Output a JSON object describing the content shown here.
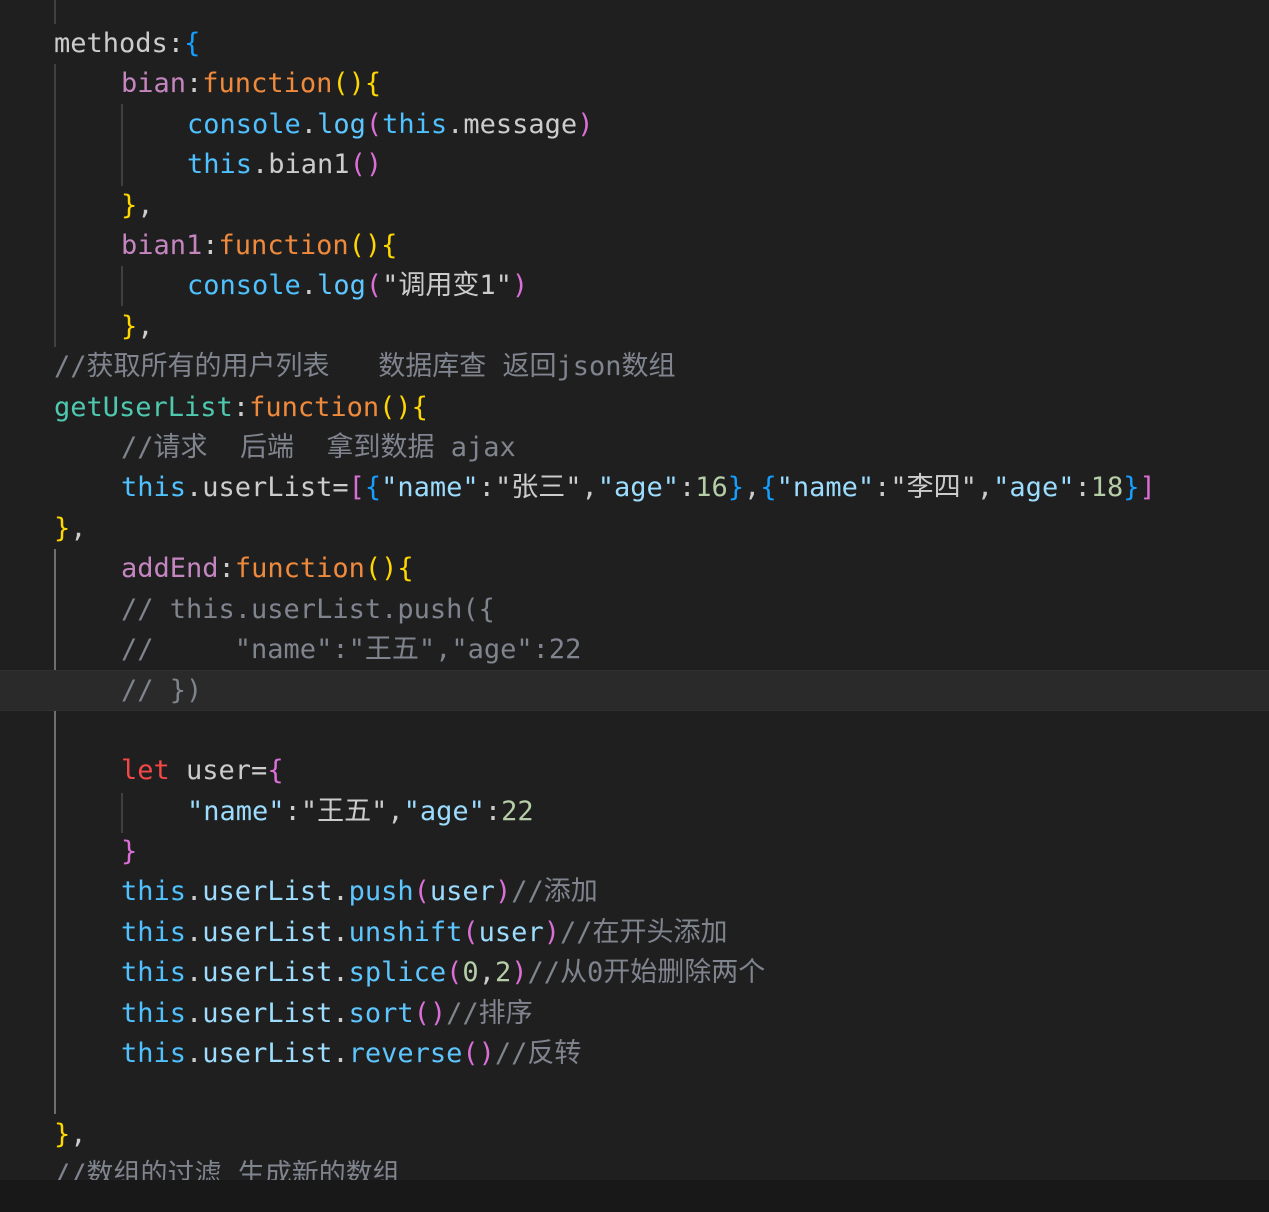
{
  "editor": {
    "lines": [
      {
        "indent": 1,
        "tokens": [
          {
            "t": "methods",
            "c": "def"
          },
          {
            "t": ":",
            "c": "def"
          },
          {
            "t": "{",
            "c": "b3"
          }
        ]
      },
      {
        "indent": 2,
        "tokens": [
          {
            "t": "bian",
            "c": "prop"
          },
          {
            "t": ":",
            "c": "def"
          },
          {
            "t": "function",
            "c": "fn"
          },
          {
            "t": "()",
            "c": "b1"
          },
          {
            "t": "{",
            "c": "b1"
          }
        ]
      },
      {
        "indent": 3,
        "tokens": [
          {
            "t": "console",
            "c": "obj"
          },
          {
            "t": ".",
            "c": "def"
          },
          {
            "t": "log",
            "c": "blue"
          },
          {
            "t": "(",
            "c": "b2"
          },
          {
            "t": "this",
            "c": "obj"
          },
          {
            "t": ".message",
            "c": "def"
          },
          {
            "t": ")",
            "c": "b2"
          }
        ]
      },
      {
        "indent": 3,
        "tokens": [
          {
            "t": "this",
            "c": "obj"
          },
          {
            "t": ".bian1",
            "c": "def"
          },
          {
            "t": "()",
            "c": "b2"
          }
        ]
      },
      {
        "indent": 2,
        "tokens": [
          {
            "t": "}",
            "c": "b1"
          },
          {
            "t": ",",
            "c": "def"
          }
        ]
      },
      {
        "indent": 2,
        "tokens": [
          {
            "t": "bian1",
            "c": "prop"
          },
          {
            "t": ":",
            "c": "def"
          },
          {
            "t": "function",
            "c": "fn"
          },
          {
            "t": "()",
            "c": "b1"
          },
          {
            "t": "{",
            "c": "b1"
          }
        ]
      },
      {
        "indent": 3,
        "tokens": [
          {
            "t": "console",
            "c": "obj"
          },
          {
            "t": ".",
            "c": "def"
          },
          {
            "t": "log",
            "c": "blue"
          },
          {
            "t": "(",
            "c": "b2"
          },
          {
            "t": "\"调用变1\"",
            "c": "def"
          },
          {
            "t": ")",
            "c": "b2"
          }
        ]
      },
      {
        "indent": 2,
        "tokens": [
          {
            "t": "}",
            "c": "b1"
          },
          {
            "t": ",",
            "c": "def"
          }
        ]
      },
      {
        "indent": 1,
        "tokens": [
          {
            "t": "//获取所有的用户列表   数据库查 返回json数组",
            "c": "com"
          }
        ]
      },
      {
        "indent": 1,
        "tokens": [
          {
            "t": "getUserList",
            "c": "green"
          },
          {
            "t": ":",
            "c": "def"
          },
          {
            "t": "function",
            "c": "fn"
          },
          {
            "t": "()",
            "c": "b1"
          },
          {
            "t": "{",
            "c": "b1"
          }
        ]
      },
      {
        "indent": 2,
        "tokens": [
          {
            "t": "//请求  后端  拿到数据 ajax",
            "c": "com"
          }
        ]
      },
      {
        "indent": 2,
        "tokens": [
          {
            "t": "this",
            "c": "obj"
          },
          {
            "t": ".userList=",
            "c": "def"
          },
          {
            "t": "[",
            "c": "b2"
          },
          {
            "t": "{",
            "c": "b3"
          },
          {
            "t": "\"name\"",
            "c": "key"
          },
          {
            "t": ":",
            "c": "def"
          },
          {
            "t": "\"张三\"",
            "c": "def"
          },
          {
            "t": ",",
            "c": "def"
          },
          {
            "t": "\"age\"",
            "c": "key"
          },
          {
            "t": ":",
            "c": "def"
          },
          {
            "t": "16",
            "c": "num"
          },
          {
            "t": "}",
            "c": "b3"
          },
          {
            "t": ",",
            "c": "def"
          },
          {
            "t": "{",
            "c": "b3"
          },
          {
            "t": "\"name\"",
            "c": "key"
          },
          {
            "t": ":",
            "c": "def"
          },
          {
            "t": "\"李四\"",
            "c": "def"
          },
          {
            "t": ",",
            "c": "def"
          },
          {
            "t": "\"age\"",
            "c": "key"
          },
          {
            "t": ":",
            "c": "def"
          },
          {
            "t": "18",
            "c": "num"
          },
          {
            "t": "}",
            "c": "b3"
          },
          {
            "t": "]",
            "c": "b2"
          }
        ]
      },
      {
        "indent": 1,
        "tokens": [
          {
            "t": "}",
            "c": "b1"
          },
          {
            "t": ",",
            "c": "def"
          }
        ]
      },
      {
        "indent": 2,
        "tokens": [
          {
            "t": "addEnd",
            "c": "prop"
          },
          {
            "t": ":",
            "c": "def"
          },
          {
            "t": "function",
            "c": "fn"
          },
          {
            "t": "()",
            "c": "b1"
          },
          {
            "t": "{",
            "c": "b1"
          }
        ]
      },
      {
        "indent": 2,
        "tokens": [
          {
            "t": "// this.userList.push({",
            "c": "com"
          }
        ]
      },
      {
        "indent": 2,
        "tokens": [
          {
            "t": "//     \"name\":\"王五\",\"age\":22",
            "c": "com"
          }
        ]
      },
      {
        "indent": 2,
        "current": true,
        "tokens": [
          {
            "t": "// })",
            "c": "com"
          }
        ]
      },
      {
        "indent": 2,
        "tokens": []
      },
      {
        "indent": 2,
        "tokens": [
          {
            "t": "let",
            "c": "let"
          },
          {
            "t": " user=",
            "c": "def"
          },
          {
            "t": "{",
            "c": "b2"
          }
        ]
      },
      {
        "indent": 3,
        "tokens": [
          {
            "t": "\"name\"",
            "c": "key"
          },
          {
            "t": ":",
            "c": "def"
          },
          {
            "t": "\"王五\"",
            "c": "def"
          },
          {
            "t": ",",
            "c": "def"
          },
          {
            "t": "\"age\"",
            "c": "key"
          },
          {
            "t": ":",
            "c": "def"
          },
          {
            "t": "22",
            "c": "num"
          }
        ]
      },
      {
        "indent": 2,
        "tokens": [
          {
            "t": "}",
            "c": "b2"
          }
        ]
      },
      {
        "indent": 2,
        "tokens": [
          {
            "t": "this",
            "c": "obj"
          },
          {
            "t": ".",
            "c": "def"
          },
          {
            "t": "userList",
            "c": "key"
          },
          {
            "t": ".",
            "c": "def"
          },
          {
            "t": "push",
            "c": "blue"
          },
          {
            "t": "(",
            "c": "b2"
          },
          {
            "t": "user",
            "c": "key"
          },
          {
            "t": ")",
            "c": "b2"
          },
          {
            "t": "//添加",
            "c": "com"
          }
        ]
      },
      {
        "indent": 2,
        "tokens": [
          {
            "t": "this",
            "c": "obj"
          },
          {
            "t": ".",
            "c": "def"
          },
          {
            "t": "userList",
            "c": "key"
          },
          {
            "t": ".",
            "c": "def"
          },
          {
            "t": "unshift",
            "c": "blue"
          },
          {
            "t": "(",
            "c": "b2"
          },
          {
            "t": "user",
            "c": "key"
          },
          {
            "t": ")",
            "c": "b2"
          },
          {
            "t": "//在开头添加",
            "c": "com"
          }
        ]
      },
      {
        "indent": 2,
        "tokens": [
          {
            "t": "this",
            "c": "obj"
          },
          {
            "t": ".",
            "c": "def"
          },
          {
            "t": "userList",
            "c": "key"
          },
          {
            "t": ".",
            "c": "def"
          },
          {
            "t": "splice",
            "c": "blue"
          },
          {
            "t": "(",
            "c": "b2"
          },
          {
            "t": "0",
            "c": "num"
          },
          {
            "t": ",",
            "c": "def"
          },
          {
            "t": "2",
            "c": "num"
          },
          {
            "t": ")",
            "c": "b2"
          },
          {
            "t": "//从0开始删除两个",
            "c": "com"
          }
        ]
      },
      {
        "indent": 2,
        "tokens": [
          {
            "t": "this",
            "c": "obj"
          },
          {
            "t": ".",
            "c": "def"
          },
          {
            "t": "userList",
            "c": "key"
          },
          {
            "t": ".",
            "c": "def"
          },
          {
            "t": "sort",
            "c": "blue"
          },
          {
            "t": "()",
            "c": "b2"
          },
          {
            "t": "//排序",
            "c": "com"
          }
        ]
      },
      {
        "indent": 2,
        "tokens": [
          {
            "t": "this",
            "c": "obj"
          },
          {
            "t": ".",
            "c": "def"
          },
          {
            "t": "userList",
            "c": "key"
          },
          {
            "t": ".",
            "c": "def"
          },
          {
            "t": "reverse",
            "c": "blue"
          },
          {
            "t": "()",
            "c": "b2"
          },
          {
            "t": "//反转",
            "c": "com"
          }
        ]
      },
      {
        "indent": 2,
        "tokens": []
      },
      {
        "indent": 1,
        "tokens": [
          {
            "t": "}",
            "c": "b1"
          },
          {
            "t": ",",
            "c": "def"
          }
        ]
      },
      {
        "indent": 1,
        "tokens": [
          {
            "t": "//数组的过滤 生成新的数组",
            "c": "com"
          }
        ]
      }
    ]
  }
}
